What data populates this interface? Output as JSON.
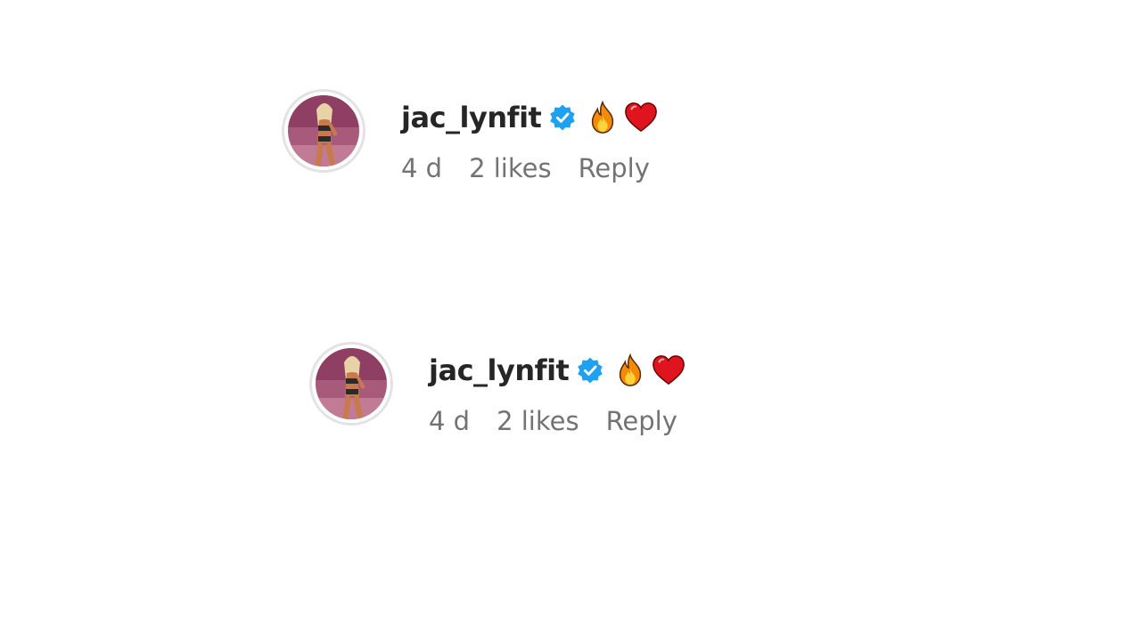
{
  "comments": [
    {
      "username": "jac_lynfit",
      "verified": true,
      "emojis": [
        "fire-icon",
        "heart-icon"
      ],
      "time": "4 d",
      "likes": "2 likes",
      "reply_label": "Reply"
    },
    {
      "username": "jac_lynfit",
      "verified": true,
      "emojis": [
        "fire-icon",
        "heart-icon"
      ],
      "time": "4 d",
      "likes": "2 likes",
      "reply_label": "Reply"
    }
  ],
  "colors": {
    "username": "#262626",
    "meta": "#737373",
    "verified": "#1ea1f2",
    "heart": "#e0141e",
    "fire": "#f58a07"
  }
}
